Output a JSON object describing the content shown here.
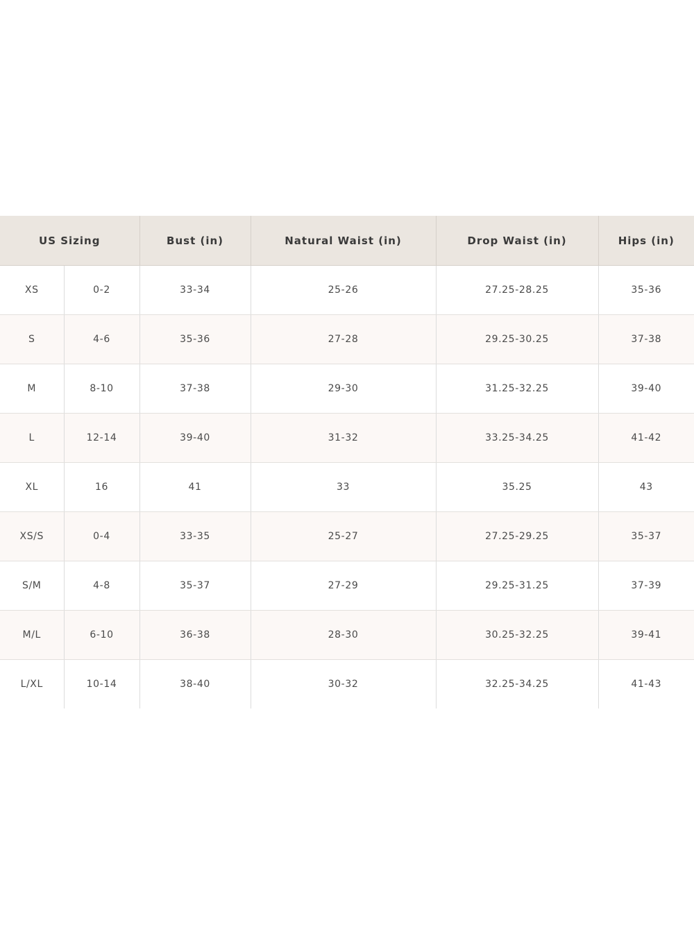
{
  "table": {
    "headers": [
      "US Sizing",
      "Bust (in)",
      "Natural Waist (in)",
      "Drop Waist (in)",
      "Hips (in)"
    ],
    "rows": [
      [
        "XS",
        "0-2",
        "33-34",
        "25-26",
        "27.25-28.25",
        "35-36"
      ],
      [
        "S",
        "4-6",
        "35-36",
        "27-28",
        "29.25-30.25",
        "37-38"
      ],
      [
        "M",
        "8-10",
        "37-38",
        "29-30",
        "31.25-32.25",
        "39-40"
      ],
      [
        "L",
        "12-14",
        "39-40",
        "31-32",
        "33.25-34.25",
        "41-42"
      ],
      [
        "XL",
        "16",
        "41",
        "33",
        "35.25",
        "43"
      ],
      [
        "XS/S",
        "0-4",
        "33-35",
        "25-27",
        "27.25-29.25",
        "35-37"
      ],
      [
        "S/M",
        "4-8",
        "35-37",
        "27-29",
        "29.25-31.25",
        "37-39"
      ],
      [
        "M/L",
        "6-10",
        "36-38",
        "28-30",
        "30.25-32.25",
        "39-41"
      ],
      [
        "L/XL",
        "10-14",
        "38-40",
        "30-32",
        "32.25-34.25",
        "41-43"
      ]
    ]
  },
  "colors": {
    "header_background": "#ebe6e0",
    "alt_row_background": "#fcf8f6",
    "text": "#3a3a3a",
    "grid_line": "#dcdcdc"
  }
}
